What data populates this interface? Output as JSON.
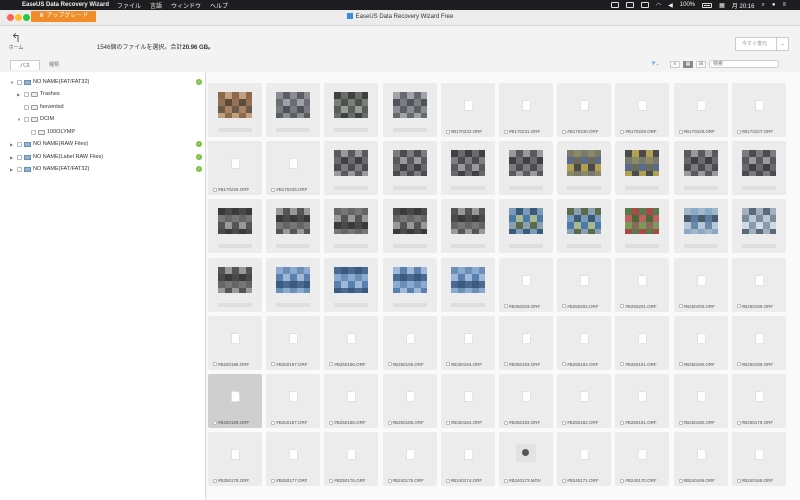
{
  "menubar": {
    "app": "EaseUS Data Recovery Wizard",
    "items": [
      "ファイル",
      "言語",
      "ウィンドウ",
      "ヘルプ"
    ],
    "battery": "100%",
    "time": "月 20:16"
  },
  "window": {
    "title": "EaseUS Data Recovery Wizard Free",
    "upgrade_label": "アップグレード",
    "home_label": "ホーム"
  },
  "info": {
    "prefix": "1546個のファイルを選択。合計",
    "size": "20.96 GB。",
    "recover_label": "今すぐ復元"
  },
  "tabs": [
    "パス",
    "種類"
  ],
  "search_placeholder": "検索",
  "tree": [
    {
      "label": "NO NAME(FAT/FAT32)",
      "level": 0,
      "expanded": true,
      "kind": "drive",
      "ok": true
    },
    {
      "label": "Trashes",
      "level": 1,
      "expanded": false,
      "kind": "folder",
      "ok": false
    },
    {
      "label": "fseventsd",
      "level": 1,
      "expanded": null,
      "kind": "folder",
      "ok": false
    },
    {
      "label": "DCIM",
      "level": 1,
      "expanded": true,
      "kind": "folder",
      "ok": false
    },
    {
      "label": "100OLYMP",
      "level": 2,
      "expanded": null,
      "kind": "folder",
      "ok": false
    },
    {
      "label": "NO NAME(RAW Files)",
      "level": 0,
      "expanded": false,
      "kind": "drive",
      "ok": true
    },
    {
      "label": "NO NAME(Label RAW Files)",
      "level": 0,
      "expanded": false,
      "kind": "drive",
      "ok": true
    },
    {
      "label": "NO NAME(FAT/FAT32)",
      "level": 0,
      "expanded": false,
      "kind": "drive",
      "ok": true
    }
  ],
  "files": [
    {
      "t": "img",
      "p": 0
    },
    {
      "t": "img",
      "p": 1
    },
    {
      "t": "img",
      "p": 2
    },
    {
      "t": "img",
      "p": 3
    },
    {
      "t": "file",
      "n": "#B170232.ORF"
    },
    {
      "t": "file",
      "n": "#B170231.ORF"
    },
    {
      "t": "file",
      "n": "#B170230.ORF"
    },
    {
      "t": "file",
      "n": "#B170229.ORF"
    },
    {
      "t": "file",
      "n": "#B170228.ORF"
    },
    {
      "t": "file",
      "n": "#B170227.ORF"
    },
    {
      "t": "file",
      "n": "#B170226.ORF"
    },
    {
      "t": "file",
      "n": "#B170225.ORF"
    },
    {
      "t": "img",
      "p": 4
    },
    {
      "t": "img",
      "p": 4
    },
    {
      "t": "img",
      "p": 4
    },
    {
      "t": "img",
      "p": 4
    },
    {
      "t": "img",
      "p": 5
    },
    {
      "t": "img",
      "p": 5
    },
    {
      "t": "img",
      "p": 4
    },
    {
      "t": "img",
      "p": 4
    },
    {
      "t": "img",
      "p": 6
    },
    {
      "t": "img",
      "p": 6
    },
    {
      "t": "img",
      "p": 6
    },
    {
      "t": "img",
      "p": 6
    },
    {
      "t": "img",
      "p": 6
    },
    {
      "t": "img",
      "p": 7
    },
    {
      "t": "img",
      "p": 7
    },
    {
      "t": "img",
      "p": 8
    },
    {
      "t": "img",
      "p": 9
    },
    {
      "t": "img",
      "p": 10
    },
    {
      "t": "img",
      "p": 6
    },
    {
      "t": "img",
      "p": 11
    },
    {
      "t": "img",
      "p": 11
    },
    {
      "t": "img",
      "p": 11
    },
    {
      "t": "img",
      "p": 11
    },
    {
      "t": "file",
      "n": "#B250203.ORF"
    },
    {
      "t": "file",
      "n": "#B250202.ORF"
    },
    {
      "t": "file",
      "n": "#B250201.ORF"
    },
    {
      "t": "file",
      "n": "#B250200.ORF"
    },
    {
      "t": "file",
      "n": "#B250199.ORF"
    },
    {
      "t": "file",
      "n": "#B250198.ORF"
    },
    {
      "t": "file",
      "n": "#B250197.ORF"
    },
    {
      "t": "file",
      "n": "#B250196.ORF"
    },
    {
      "t": "file",
      "n": "#B250195.ORF"
    },
    {
      "t": "file",
      "n": "#B250194.ORF"
    },
    {
      "t": "file",
      "n": "#B250193.ORF"
    },
    {
      "t": "file",
      "n": "#B250192.ORF"
    },
    {
      "t": "file",
      "n": "#B250191.ORF"
    },
    {
      "t": "file",
      "n": "#B250190.ORF"
    },
    {
      "t": "file",
      "n": "#B250189.ORF"
    },
    {
      "t": "file",
      "n": "#B250188.ORF",
      "sel": true
    },
    {
      "t": "file",
      "n": "#B250187.ORF"
    },
    {
      "t": "file",
      "n": "#B250186.ORF"
    },
    {
      "t": "file",
      "n": "#B250185.ORF"
    },
    {
      "t": "file",
      "n": "#B250184.ORF"
    },
    {
      "t": "file",
      "n": "#B250183.ORF"
    },
    {
      "t": "file",
      "n": "#B250182.ORF"
    },
    {
      "t": "file",
      "n": "#B250181.ORF"
    },
    {
      "t": "file",
      "n": "#B250180.ORF"
    },
    {
      "t": "file",
      "n": "#B250179.ORF"
    },
    {
      "t": "file",
      "n": "#B250178.ORF"
    },
    {
      "t": "file",
      "n": "#B250177.ORF"
    },
    {
      "t": "file",
      "n": "#B250176.ORF"
    },
    {
      "t": "file",
      "n": "#B240175.ORF"
    },
    {
      "t": "file",
      "n": "#B240174.ORF"
    },
    {
      "t": "mov",
      "n": "#B240173.MOV"
    },
    {
      "t": "file",
      "n": "#B240171.ORF"
    },
    {
      "t": "file",
      "n": "#B240170.ORF"
    },
    {
      "t": "file",
      "n": "#B240169.ORF"
    },
    {
      "t": "file",
      "n": "#B240168.ORF"
    }
  ],
  "palettes": [
    [
      "#8a6a4a",
      "#a88462",
      "#5e4a38",
      "#c0a080",
      "#6e5a48",
      "#947058"
    ],
    [
      "#6a6e72",
      "#8a8e92",
      "#4e5256",
      "#9ea2a6",
      "#5a5e62",
      "#787c80"
    ],
    [
      "#5a5e5a",
      "#7a7e7a",
      "#3e423e",
      "#9a9e9a",
      "#4e524e",
      "#6a6e6a"
    ],
    [
      "#666a6e",
      "#8a8e92",
      "#505458",
      "#a0a4a8",
      "#5c6064",
      "#7a7e82"
    ],
    [
      "#5a5a5e",
      "#7c7c80",
      "#404044",
      "#9a9a9e",
      "#4c4c50",
      "#6a6a6e"
    ],
    [
      "#6a6a5a",
      "#8a8a6a",
      "#b0a050",
      "#5a6a8a",
      "#7a7a6a",
      "#4a4a4a"
    ],
    [
      "#555555",
      "#777777",
      "#3a3a3a",
      "#999999",
      "#666666",
      "#4a4a4a"
    ],
    [
      "#4a7aa8",
      "#7a9aba",
      "#5a6a4a",
      "#a8b890",
      "#3a5a7a",
      "#8aa0b0"
    ],
    [
      "#a84848",
      "#7a9a5a",
      "#c06060",
      "#5a7a4a",
      "#8a6a5a",
      "#4a6a3a"
    ],
    [
      "#5a7aa0",
      "#8aa8c8",
      "#b8c8d8",
      "#4a5a6a",
      "#a0b8c8",
      "#6a8aa8"
    ],
    [
      "#8a9aa8",
      "#b8c8d4",
      "#5a6a7a",
      "#d0dae4",
      "#7a8a98",
      "#a0b0bc"
    ],
    [
      "#5a80b0",
      "#8aaad0",
      "#4a6a90",
      "#a0b8d8",
      "#6a90b8",
      "#3a5a80"
    ]
  ]
}
